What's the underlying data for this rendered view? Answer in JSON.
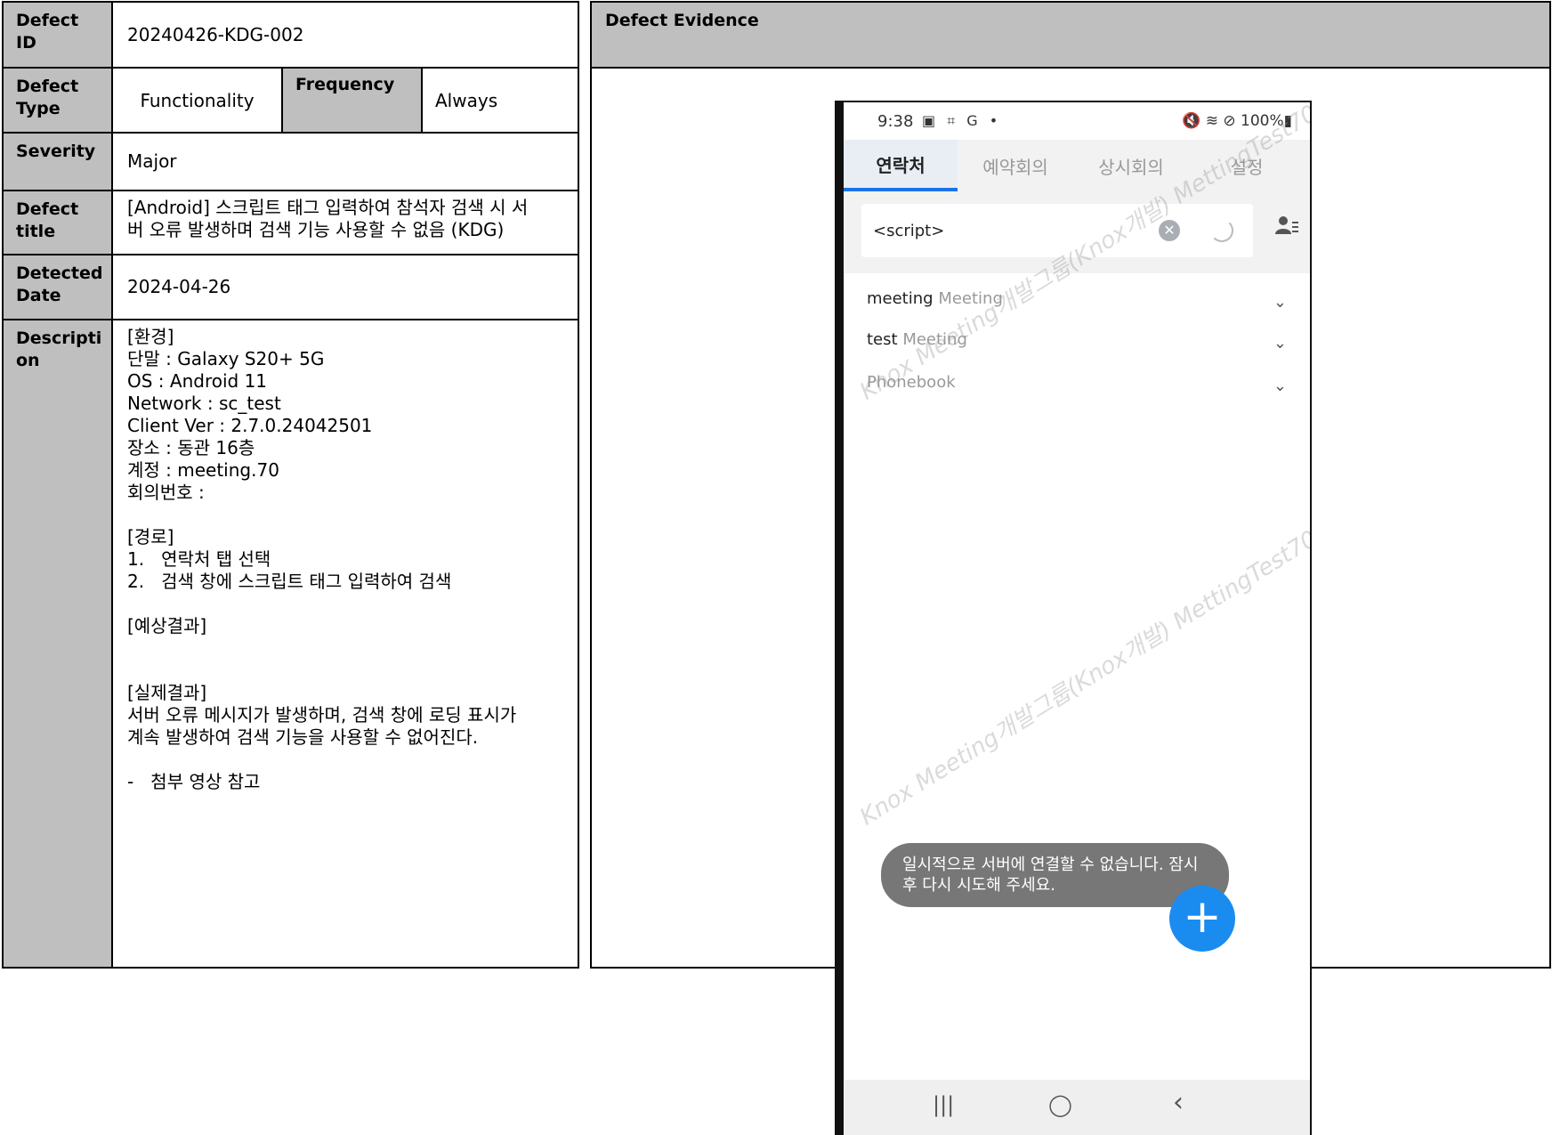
{
  "defect": {
    "id_label": "Defect\nID",
    "id_value": "20240426-KDG-002",
    "type_label": "Defect\nType",
    "type_value": "Functionality",
    "frequency_label": "Frequency",
    "frequency_value": "Always",
    "severity_label": "Severity",
    "severity_value": "Major",
    "title_label": "Defect\ntitle",
    "title_value": "[Android] 스크립트 태그 입력하여 참석자 검색 시 서\n버 오류 발생하며 검색 기능 사용할 수 없음 (KDG)",
    "date_label": "Detected\nDate",
    "date_value": "2024-04-26",
    "description_label": "Descripti\non",
    "description_value": "[환경]\n단말 : Galaxy S20+ 5G\nOS : Android 11\nNetwork : sc_test\nClient Ver : 2.7.0.24042501\n장소 : 동관 16층\n계정 : meeting.70\n회의번호 :\n\n[경로]\n1.   연락처 탭 선택\n2.   검색 창에 스크립트 태그 입력하여 검색\n\n[예상결과]\n\n\n[실제결과]\n서버 오류 메시지가 발생하며, 검색 창에 로딩 표시가\n계속 발생하여 검색 기능을 사용할 수 없어진다.\n\n-   첨부 영상 참고"
  },
  "evidence": {
    "header": "Defect Evidence"
  },
  "phone": {
    "status_time": "9:38",
    "status_left_icons": "▣ ⌗ G •",
    "status_right": "🔇 ≋ ⊘ 100%▮",
    "tabs": [
      "연락처",
      "예약회의",
      "상시회의",
      "설정"
    ],
    "active_tab": 0,
    "search_value": "<script>",
    "list": [
      {
        "name": "meeting",
        "sub": "Meeting"
      },
      {
        "name": "test",
        "sub": "Meeting"
      },
      {
        "name": "",
        "sub": "Phonebook"
      }
    ],
    "toast": "일시적으로 서버에 연결할 수 없습니다. 잠시\n후 다시 시도해 주세요.",
    "fab_symbol": "+",
    "watermark": "Knox Meeting개발그룹(Knox개발) MettingTest70",
    "nav": [
      "|||",
      "◯",
      "‹"
    ],
    "colors": {
      "accent": "#1a73e8",
      "fab": "#1a8cf0",
      "toast": "#777777",
      "header": "#bfbfbf"
    }
  }
}
